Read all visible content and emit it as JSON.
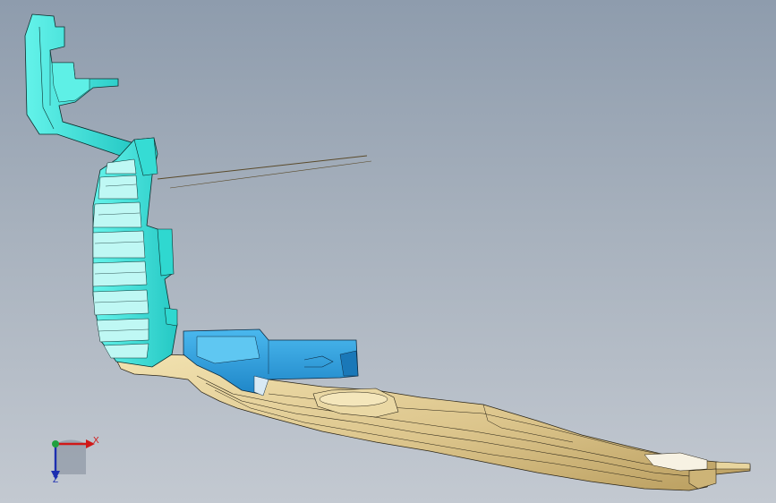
{
  "viewport": {
    "background_top": "#8e9cad",
    "background_bottom": "#c3c9d1"
  },
  "model": {
    "colors": {
      "cyan_part": "#3ee6de",
      "blue_part": "#2aa6e0",
      "tan_part": "#e3cf98",
      "edge": "#1c2a2a"
    }
  },
  "triad": {
    "x_label": "X",
    "z_label": "Z",
    "x_color": "#d01818",
    "y_color": "#20a040",
    "z_color": "#1d2fb0"
  }
}
